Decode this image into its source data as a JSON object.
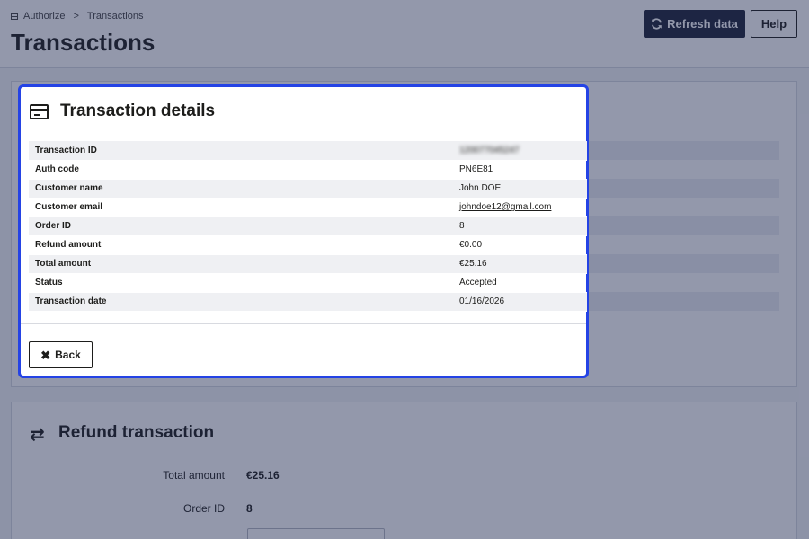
{
  "breadcrumb": {
    "icon": "store-icon",
    "parent": "Authorize",
    "separator": ">",
    "current": "Transactions"
  },
  "page": {
    "title": "Transactions"
  },
  "toolbar": {
    "refresh_label": "Refresh data",
    "refresh_icon": "refresh-icon",
    "help_label": "Help"
  },
  "modal": {
    "title": "Transaction details",
    "icon": "credit-card-icon",
    "rows": [
      {
        "label": "Transaction ID",
        "value": "120077045247"
      },
      {
        "label": "Auth code",
        "value": "PN6E81"
      },
      {
        "label": "Customer name",
        "value": "John DOE"
      },
      {
        "label": "Customer email",
        "value": "johndoe12@gmail.com"
      },
      {
        "label": "Order ID",
        "value": "8"
      },
      {
        "label": "Refund amount",
        "value": "€0.00"
      },
      {
        "label": "Total amount",
        "value": "€25.16"
      },
      {
        "label": "Status",
        "value": "Accepted"
      },
      {
        "label": "Transaction date",
        "value": "01/16/2026"
      }
    ],
    "back_label": "Back",
    "back_icon": "close-icon"
  },
  "refund": {
    "title": "Refund transaction",
    "icon": "exchange-arrows-icon",
    "rows": [
      {
        "label": "Total amount",
        "value": "€25.16"
      },
      {
        "label": "Order ID",
        "value": "8"
      }
    ]
  },
  "colors": {
    "modal_border": "#2443e5",
    "primary_button": "#1e2338"
  }
}
